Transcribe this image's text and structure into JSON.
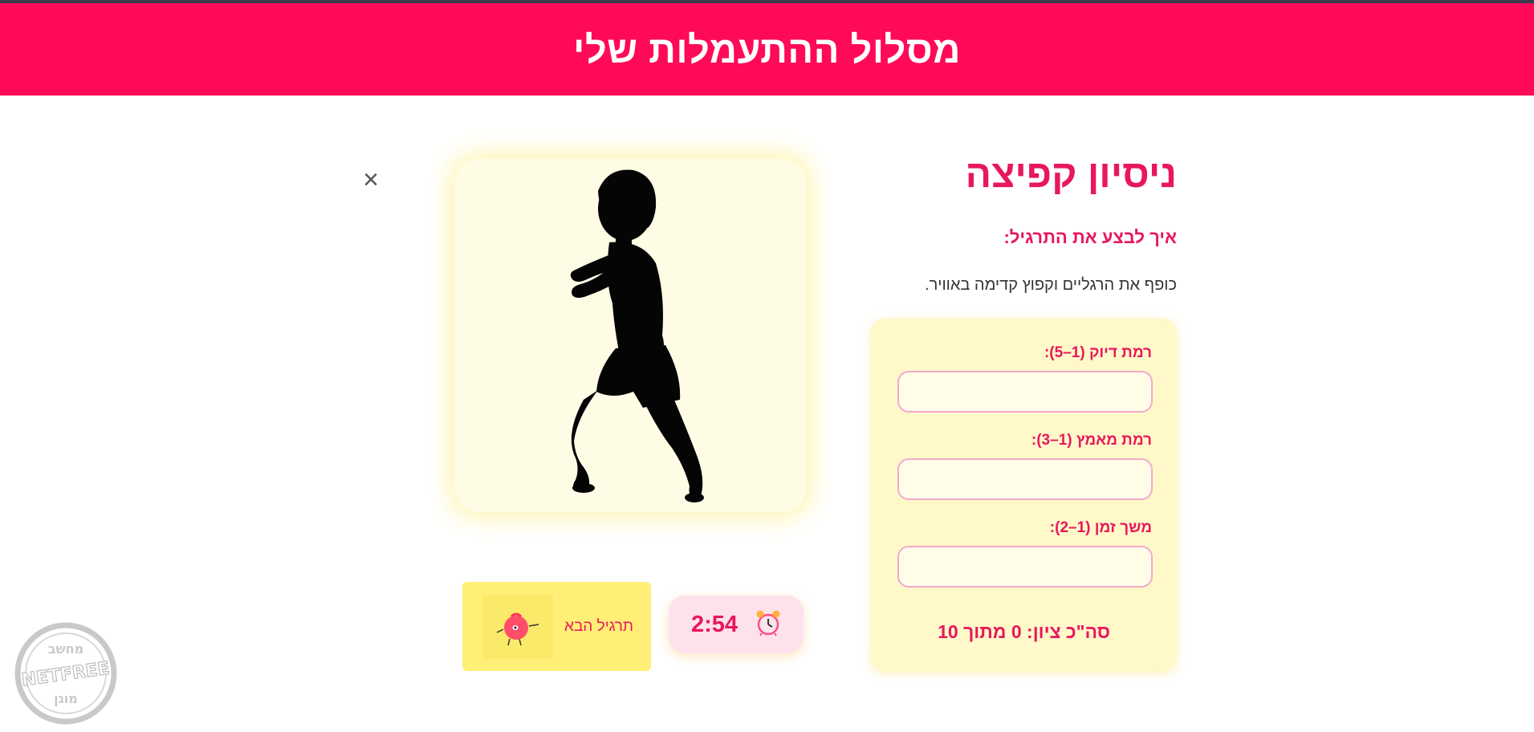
{
  "header": {
    "title": "מסלול ההתעמלות שלי"
  },
  "exercise": {
    "title": "ניסיון קפיצה",
    "how_title": "איך לבצע את התרגיל:",
    "description": "כופף את הרגליים וקפוץ קדימה באוויר."
  },
  "close": {
    "label": "×"
  },
  "form": {
    "fields": [
      {
        "label": "רמת דיוק (1–5):",
        "value": ""
      },
      {
        "label": "רמת מאמץ (1–3):",
        "value": ""
      },
      {
        "label": "משך זמן (1–2):",
        "value": ""
      }
    ],
    "total": "סה\"כ ציון: 0 מתוך 10"
  },
  "timer": {
    "value": "2:54",
    "icon": "alarm-clock-icon"
  },
  "next_button": {
    "label": "תרגיל הבא",
    "icon": "mascot-icon"
  },
  "badge": {
    "top_text": "מחשב",
    "middle_text": "NETFREE",
    "bottom_text": "מוגן"
  },
  "colors": {
    "accent": "#ff0a58",
    "text_accent": "#e8175d",
    "card_yellow": "#fff8c8",
    "button_yellow": "#ffef76"
  }
}
